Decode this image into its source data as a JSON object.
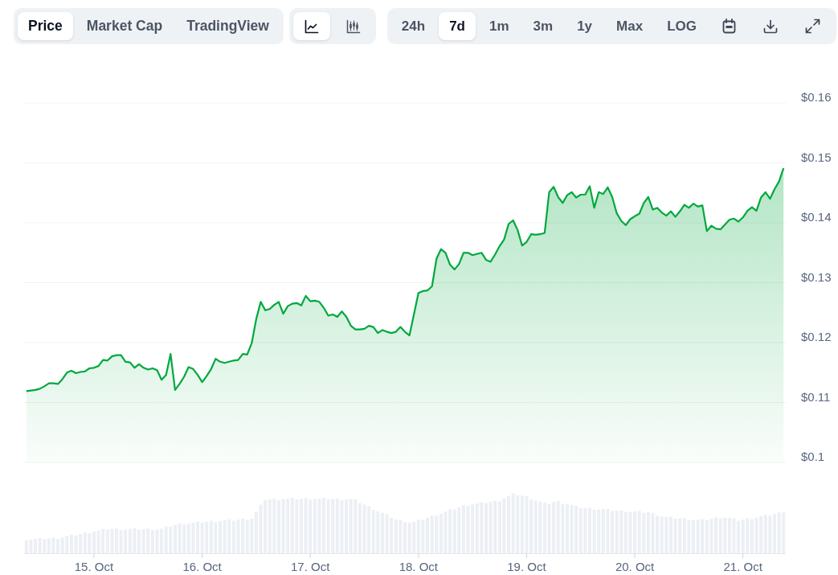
{
  "toolbar": {
    "view_tabs": [
      {
        "label": "Price",
        "selected": true
      },
      {
        "label": "Market Cap",
        "selected": false
      },
      {
        "label": "TradingView",
        "selected": false
      }
    ],
    "chart_types": [
      {
        "kind": "line",
        "selected": true
      },
      {
        "kind": "candlestick",
        "selected": false
      }
    ],
    "ranges": [
      {
        "label": "24h",
        "selected": false
      },
      {
        "label": "7d",
        "selected": true
      },
      {
        "label": "1m",
        "selected": false
      },
      {
        "label": "3m",
        "selected": false
      },
      {
        "label": "1y",
        "selected": false
      },
      {
        "label": "Max",
        "selected": false
      }
    ],
    "log_scale": {
      "label": "LOG",
      "on": false
    }
  },
  "chart": {
    "chart_data": {
      "type": "area",
      "grid": true,
      "series": [
        {
          "color": "#00a83e",
          "values": [
            0.1119,
            0.112,
            0.1121,
            0.1123,
            0.1127,
            0.1132,
            0.1132,
            0.1131,
            0.1139,
            0.115,
            0.1153,
            0.1149,
            0.1151,
            0.1152,
            0.1157,
            0.1158,
            0.1161,
            0.1171,
            0.117,
            0.1177,
            0.1179,
            0.1179,
            0.1168,
            0.1167,
            0.1158,
            0.1164,
            0.1158,
            0.1155,
            0.1157,
            0.1154,
            0.1138,
            0.1146,
            0.1181,
            0.1121,
            0.1131,
            0.1143,
            0.1159,
            0.1156,
            0.1146,
            0.1134,
            0.1144,
            0.1156,
            0.1173,
            0.1168,
            0.1166,
            0.1168,
            0.117,
            0.1171,
            0.1181,
            0.118,
            0.1199,
            0.1239,
            0.1268,
            0.1254,
            0.1256,
            0.1263,
            0.1268,
            0.1248,
            0.1261,
            0.1265,
            0.1266,
            0.1262,
            0.1278,
            0.1269,
            0.127,
            0.1268,
            0.1258,
            0.1245,
            0.1247,
            0.1243,
            0.1252,
            0.1243,
            0.1228,
            0.1222,
            0.1222,
            0.1223,
            0.1228,
            0.1226,
            0.1216,
            0.1221,
            0.1218,
            0.1216,
            0.1218,
            0.1226,
            0.1218,
            0.1212,
            0.1247,
            0.1283,
            0.1286,
            0.1287,
            0.1294,
            0.134,
            0.1356,
            0.135,
            0.133,
            0.1322,
            0.1331,
            0.135,
            0.135,
            0.1346,
            0.1348,
            0.135,
            0.1338,
            0.1335,
            0.1347,
            0.1361,
            0.1372,
            0.1398,
            0.1404,
            0.1388,
            0.1362,
            0.1368,
            0.1381,
            0.138,
            0.1381,
            0.1383,
            0.1451,
            0.146,
            0.1443,
            0.1433,
            0.1446,
            0.1451,
            0.1442,
            0.1447,
            0.1447,
            0.1461,
            0.1425,
            0.1451,
            0.1448,
            0.1459,
            0.1443,
            0.1416,
            0.1403,
            0.1396,
            0.1406,
            0.1411,
            0.1415,
            0.1433,
            0.1443,
            0.1422,
            0.1425,
            0.1417,
            0.1412,
            0.1419,
            0.141,
            0.1419,
            0.143,
            0.1425,
            0.1432,
            0.1427,
            0.1429,
            0.1386,
            0.1395,
            0.139,
            0.1389,
            0.1397,
            0.1405,
            0.1407,
            0.1402,
            0.1409,
            0.142,
            0.1426,
            0.142,
            0.1442,
            0.1451,
            0.144,
            0.1456,
            0.1469,
            0.1491
          ]
        }
      ],
      "ylim": [
        0.1,
        0.16
      ],
      "yticks": [
        {
          "value": 0.1,
          "label": "$0.1"
        },
        {
          "value": 0.11,
          "label": "$0.11"
        },
        {
          "value": 0.12,
          "label": "$0.12"
        },
        {
          "value": 0.13,
          "label": "$0.13"
        },
        {
          "value": 0.14,
          "label": "$0.14"
        },
        {
          "value": 0.15,
          "label": "$0.15"
        },
        {
          "value": 0.16,
          "label": "$0.16"
        }
      ]
    },
    "date_labels": [
      "15. Oct",
      "16. Oct",
      "17. Oct",
      "18. Oct",
      "19. Oct",
      "20. Oct",
      "21. Oct"
    ]
  }
}
